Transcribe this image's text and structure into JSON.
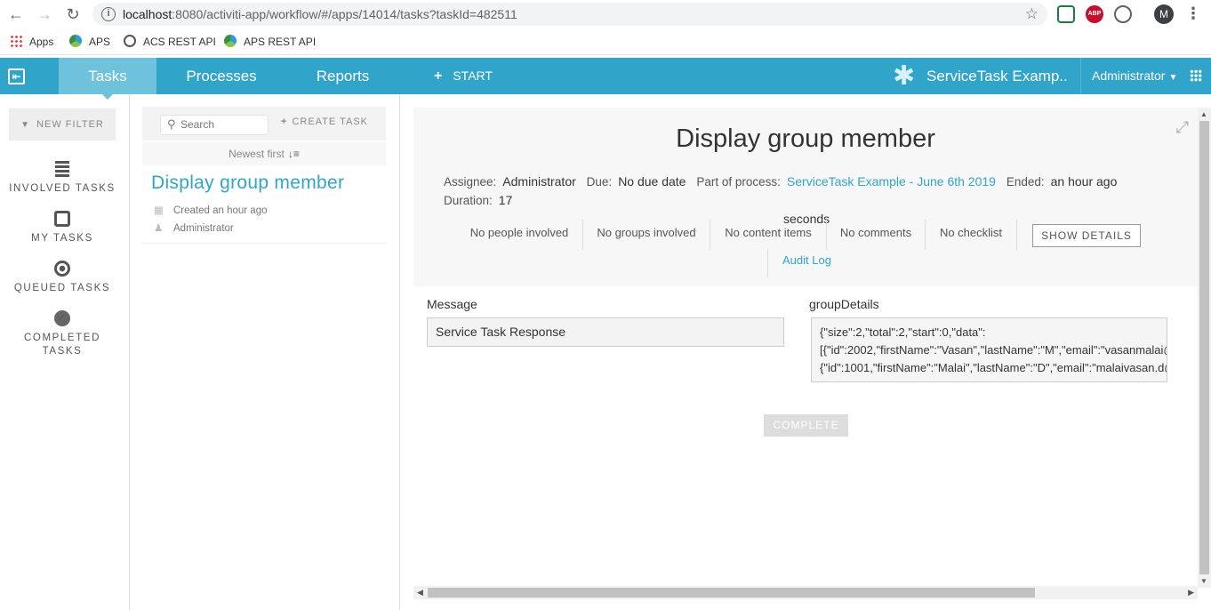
{
  "browser": {
    "url_host": "localhost",
    "url_path": ":8080/activiti-app/workflow/#/apps/14014/tasks?taskId=482511",
    "profile_initial": "M",
    "abp_label": "ABP",
    "bookmarks": [
      "Apps",
      "APS",
      "ACS REST API",
      "APS REST API"
    ]
  },
  "header": {
    "tabs": [
      "Tasks",
      "Processes",
      "Reports"
    ],
    "active_tab": "Tasks",
    "start_label": "START",
    "app_title": "ServiceTask Examp...",
    "user": "Administrator",
    "accent_color": "#31a5c9"
  },
  "filters": {
    "new_filter": "NEW FILTER",
    "items": [
      "INVOLVED TASKS",
      "MY TASKS",
      "QUEUED TASKS",
      "COMPLETED TASKS"
    ]
  },
  "task_list": {
    "search_placeholder": "Search",
    "create_task": "CREATE TASK",
    "sort_label": "Newest first",
    "task": {
      "name": "Display group member",
      "created": "Created an hour ago",
      "assignee": "Administrator"
    }
  },
  "detail": {
    "title": "Display group member",
    "assignee_label": "Assignee:",
    "assignee": "Administrator",
    "due_label": "Due:",
    "due": "No due date",
    "process_label": "Part of process:",
    "process": "ServiceTask Example - June 6th 2019",
    "ended_label": "Ended:",
    "ended": "an hour ago",
    "duration_label": "Duration:",
    "duration_value": "17",
    "duration_unit": "seconds",
    "people": "No people involved",
    "groups": "No groups involved",
    "content": "No content items",
    "comments": "No comments",
    "checklist": "No checklist",
    "show_details": "SHOW DETAILS",
    "audit_log": "Audit Log"
  },
  "form": {
    "message_label": "Message",
    "message_value": "Service Task Response",
    "group_label": "groupDetails",
    "group_value": "{\"size\":2,\"total\":2,\"start\":0,\"data\":\n[{\"id\":2002,\"firstName\":\"Vasan\",\"lastName\":\"M\",\"email\":\"vasanmalai@g\n{\"id\":1001,\"firstName\":\"Malai\",\"lastName\":\"D\",\"email\":\"malaivasan.d@g",
    "complete": "COMPLETE"
  }
}
